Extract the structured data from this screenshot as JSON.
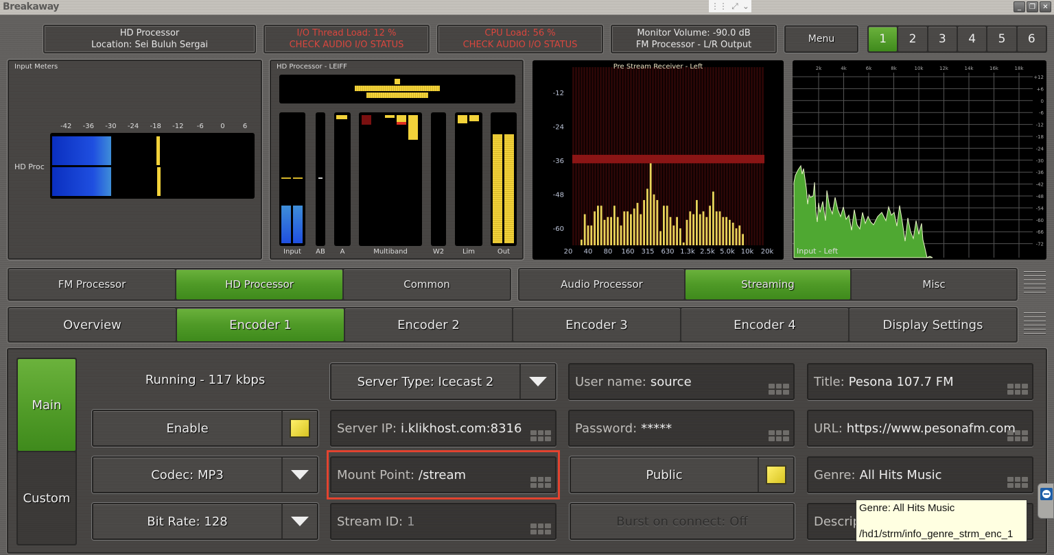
{
  "window": {
    "app_title": "Breakaway",
    "controls": {
      "minimize": "_",
      "restore": "❐",
      "close": "✕"
    },
    "remote_toolbar_icons": [
      "grid-icon",
      "fullscreen-icon",
      "chevron-down-icon"
    ]
  },
  "header": {
    "processor": {
      "line1": "HD Processor",
      "line2": "Location: Sei Buluh Sergai"
    },
    "io_thread": {
      "line1": "I/O Thread Load: 12 %",
      "line2": "CHECK AUDIO I/O STATUS"
    },
    "cpu": {
      "line1": "CPU Load: 56 %",
      "line2": "CHECK AUDIO I/O STATUS"
    },
    "monitor": {
      "line1": "Monitor Volume: -90.0 dB",
      "line2": "FM Processor - L/R Output"
    },
    "menu_label": "Menu",
    "presets": [
      "1",
      "2",
      "3",
      "4",
      "5",
      "6"
    ],
    "active_preset": "1"
  },
  "input_meters": {
    "title": "Input Meters",
    "channel_label": "HD Proc",
    "scale": [
      "-42",
      "-36",
      "-30",
      "-24",
      "-18",
      "-12",
      "-6",
      "0",
      "6"
    ],
    "level_db": -30,
    "peak_db": -18
  },
  "leiff": {
    "title": "HD Processor - LEIFF",
    "labels": [
      "Input",
      "AB",
      "A",
      "Multiband",
      "W2",
      "Lim",
      "Out"
    ]
  },
  "rta": {
    "title": "Pre Stream Receiver - Left",
    "y_ticks": [
      "-12",
      "-24",
      "-36",
      "-48",
      "-60"
    ],
    "x_ticks": [
      "20",
      "40",
      "80",
      "160",
      "315",
      "630",
      "1.3k",
      "2.5k",
      "5.0k",
      "10k",
      "20k"
    ],
    "bars_db": [
      -64,
      -55,
      -59,
      -59,
      -54,
      -52,
      -52,
      -57,
      -56,
      -56,
      -52,
      -56,
      -59,
      -54,
      -54,
      -55,
      -53,
      -51,
      -55,
      -50,
      -46,
      -37,
      -48,
      -50,
      -61,
      -52,
      -52,
      -56,
      -59,
      -56,
      -60,
      -65,
      -57,
      -54,
      -55,
      -50,
      -55,
      -54,
      -56,
      -52,
      -47,
      -54,
      -54,
      -56,
      -56,
      -57,
      -58,
      -60,
      -59,
      -62,
      -66
    ]
  },
  "fft": {
    "title": "Input - Left",
    "x_ticks": [
      "2k",
      "4k",
      "6k",
      "8k",
      "10k",
      "12k",
      "14k",
      "16k",
      "18k"
    ],
    "y_ticks": [
      "+12",
      "+6",
      "0",
      "-6",
      "-12",
      "-18",
      "-24",
      "-30",
      "-36",
      "-42",
      "-48",
      "-54",
      "-60",
      "-66",
      "-72"
    ]
  },
  "nav": {
    "row1": [
      {
        "label": "FM Processor",
        "active": false
      },
      {
        "label": "HD Processor",
        "active": true
      },
      {
        "label": "Common",
        "active": false
      }
    ],
    "row1b": [
      {
        "label": "Audio Processor",
        "active": false
      },
      {
        "label": "Streaming",
        "active": true
      },
      {
        "label": "Misc",
        "active": false
      }
    ],
    "row2": [
      {
        "label": "Overview",
        "active": false
      },
      {
        "label": "Encoder 1",
        "active": true
      },
      {
        "label": "Encoder 2",
        "active": false
      },
      {
        "label": "Encoder 3",
        "active": false
      },
      {
        "label": "Encoder 4",
        "active": false
      },
      {
        "label": "Display Settings",
        "active": false
      }
    ]
  },
  "encoder": {
    "side_tabs": [
      {
        "label": "Main",
        "active": true
      },
      {
        "label": "Custom",
        "active": false
      }
    ],
    "status": "Running - 117 kbps",
    "enable_label": "Enable",
    "enable_checked": true,
    "codec": "Codec: MP3",
    "bitrate": "Bit Rate: 128",
    "server_type": "Server Type: Icecast 2",
    "server_ip": {
      "label": "Server IP:",
      "value": "i.klikhost.com:8316"
    },
    "mount_point": {
      "label": "Mount Point:",
      "value": "/stream"
    },
    "stream_id": {
      "label": "Stream ID:",
      "value": "1"
    },
    "username": {
      "label": "User name:",
      "value": "source"
    },
    "password": {
      "label": "Password:",
      "value": "*****"
    },
    "public_label": "Public",
    "public_checked": true,
    "burst": "Burst on connect: Off",
    "title": {
      "label": "Title:",
      "value": "Pesona 107.7 FM"
    },
    "url": {
      "label": "URL:",
      "value": "https://www.pesonafm.com"
    },
    "genre": {
      "label": "Genre:",
      "value": "All Hits Music"
    },
    "description": {
      "label": "Descrip"
    }
  },
  "tooltip": {
    "line1": "Genre: All Hits Music",
    "line2": "/hd1/strm/info_genre_strm_enc_1"
  },
  "colors": {
    "accent_green": "#4f9a27",
    "warning_red": "#d9463e",
    "meter_yellow": "#f2d23a",
    "meter_blue": "#1f4fe0",
    "fft_green": "#5fbf3a",
    "highlight_red": "#e3432f"
  }
}
